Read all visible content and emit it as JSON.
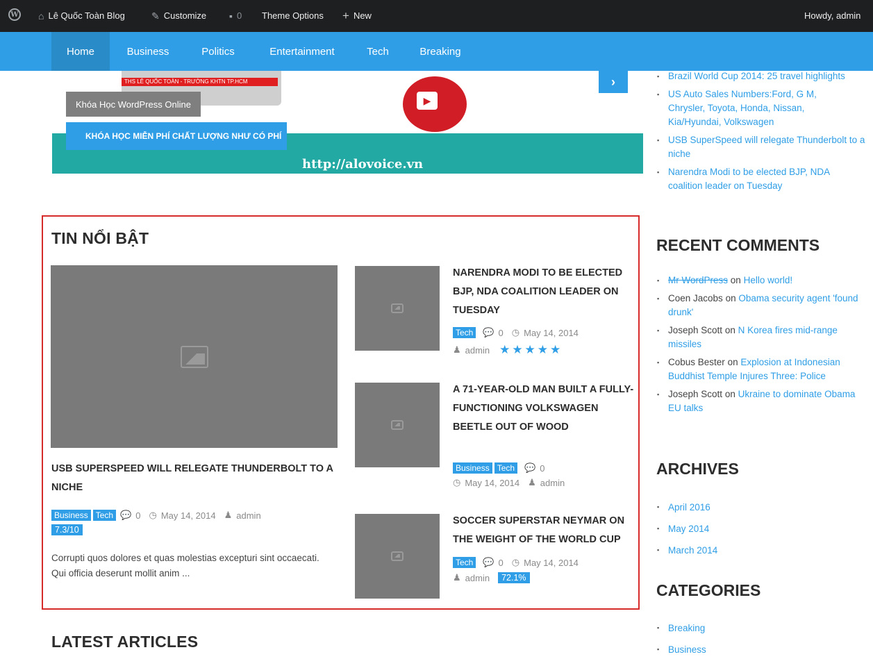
{
  "adminbar": {
    "wp_icon": "wordpress-logo-icon",
    "site_name": "Lê Quốc Toàn Blog",
    "customize": "Customize",
    "comments_count": "0",
    "theme_options": "Theme Options",
    "new": "New",
    "howdy": "Howdy, admin"
  },
  "nav": {
    "items": [
      "Home",
      "Business",
      "Politics",
      "Entertainment",
      "Tech",
      "Breaking"
    ],
    "active": "Home"
  },
  "slider": {
    "monitor_text": "THS LÊ QUỐC TOÀN - TRƯỜNG KHTN TP.HCM",
    "caption_title": "Khóa Học WordPress Online",
    "caption_sub": "KHÓA HỌC MIỄN PHÍ CHẤT LƯỢNG NHƯ CÓ PHÍ",
    "url": "http://alovoice.vn",
    "next": "›"
  },
  "featured": {
    "title": "TIN NỔI BẬT",
    "main": {
      "title": "USB SUPERSPEED WILL RELEGATE THUNDERBOLT TO A NICHE",
      "tags": [
        "Business",
        "Tech"
      ],
      "comments": "0",
      "date": "May 14, 2014",
      "author": "admin",
      "score": "7.3/10",
      "excerpt": "Corrupti quos dolores et quas molestias excepturi sint occaecati. Qui officia deserunt mollit anim ..."
    },
    "items": [
      {
        "title": "NARENDRA MODI TO BE ELECTED BJP, NDA COALITION LEADER ON TUESDAY",
        "tag": "Tech",
        "comments": "0",
        "date": "May 14, 2014",
        "author": "admin",
        "rating_stars": 5
      },
      {
        "title": "A 71-YEAR-OLD MAN BUILT A FULLY-FUNCTIONING VOLKSWAGEN BEETLE OUT OF WOOD",
        "tags": [
          "Business",
          "Tech"
        ],
        "comments": "0",
        "date": "May 14, 2014",
        "author": "admin"
      },
      {
        "title": "SOCCER SUPERSTAR NEYMAR ON THE WEIGHT OF THE WORLD CUP",
        "tag": "Tech",
        "comments": "0",
        "date": "May 14, 2014",
        "author": "admin",
        "score": "72.1%"
      }
    ]
  },
  "latest": {
    "title": "LATEST ARTICLES"
  },
  "sidebar": {
    "recent_posts": [
      "Brazil World Cup 2014: 25 travel highlights",
      "US Auto Sales Numbers:Ford, G M, Chrysler, Toyota, Honda, Nissan, Kia/Hyundai, Volkswagen",
      "USB SuperSpeed will relegate Thunderbolt to a niche",
      "Narendra Modi to be elected BJP, NDA coalition leader on Tuesday"
    ],
    "recent_comments_title": "RECENT COMMENTS",
    "recent_comments": [
      {
        "author": "Mr WordPress",
        "on": "on",
        "post": "Hello world!"
      },
      {
        "author": "Coen Jacobs",
        "on": "on",
        "post": "Obama security agent 'found drunk'"
      },
      {
        "author": "Joseph Scott",
        "on": "on",
        "post": "N Korea fires mid-range missiles"
      },
      {
        "author": "Cobus Bester",
        "on": "on",
        "post": "Explosion at Indonesian Buddhist Temple Injures Three: Police"
      },
      {
        "author": "Joseph Scott",
        "on": "on",
        "post": "Ukraine to dominate Obama EU talks"
      }
    ],
    "archives_title": "ARCHIVES",
    "archives": [
      "April 2016",
      "May 2014",
      "March 2014"
    ],
    "categories_title": "CATEGORIES",
    "categories": [
      "Breaking",
      "Business"
    ]
  }
}
